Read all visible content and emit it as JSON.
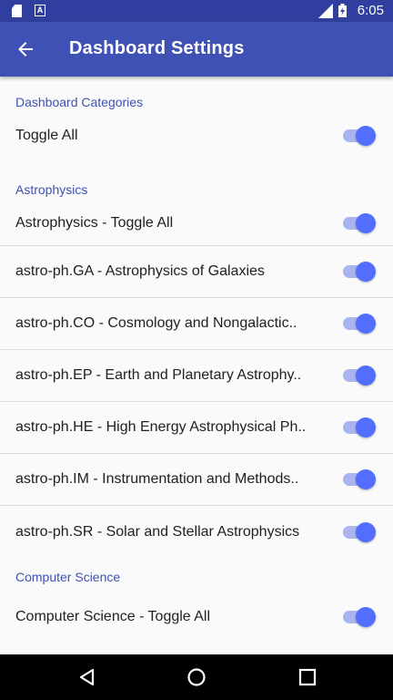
{
  "status_bar": {
    "time": "6:05",
    "network": "LTE"
  },
  "app_bar": {
    "title": "Dashboard Settings"
  },
  "sections": [
    {
      "header": "Dashboard Categories",
      "items": [
        {
          "label": "Toggle All",
          "checked": true
        }
      ]
    },
    {
      "header": "Astrophysics",
      "items": [
        {
          "label": "Astrophysics - Toggle All",
          "checked": true
        },
        {
          "label": "astro-ph.GA - Astrophysics of Galaxies",
          "checked": true
        },
        {
          "label": "astro-ph.CO - Cosmology and Nongalactic..",
          "checked": true
        },
        {
          "label": "astro-ph.EP - Earth and Planetary Astrophy..",
          "checked": true
        },
        {
          "label": "astro-ph.HE - High Energy Astrophysical Ph..",
          "checked": true
        },
        {
          "label": "astro-ph.IM - Instrumentation and Methods..",
          "checked": true
        },
        {
          "label": "astro-ph.SR - Solar and Stellar Astrophysics",
          "checked": true
        }
      ]
    },
    {
      "header": "Computer Science",
      "items": [
        {
          "label": "Computer Science - Toggle All",
          "checked": true
        }
      ]
    }
  ],
  "colors": {
    "primary": "#3f51b5",
    "primary_dark": "#303f9f",
    "accent": "#536dfe"
  }
}
